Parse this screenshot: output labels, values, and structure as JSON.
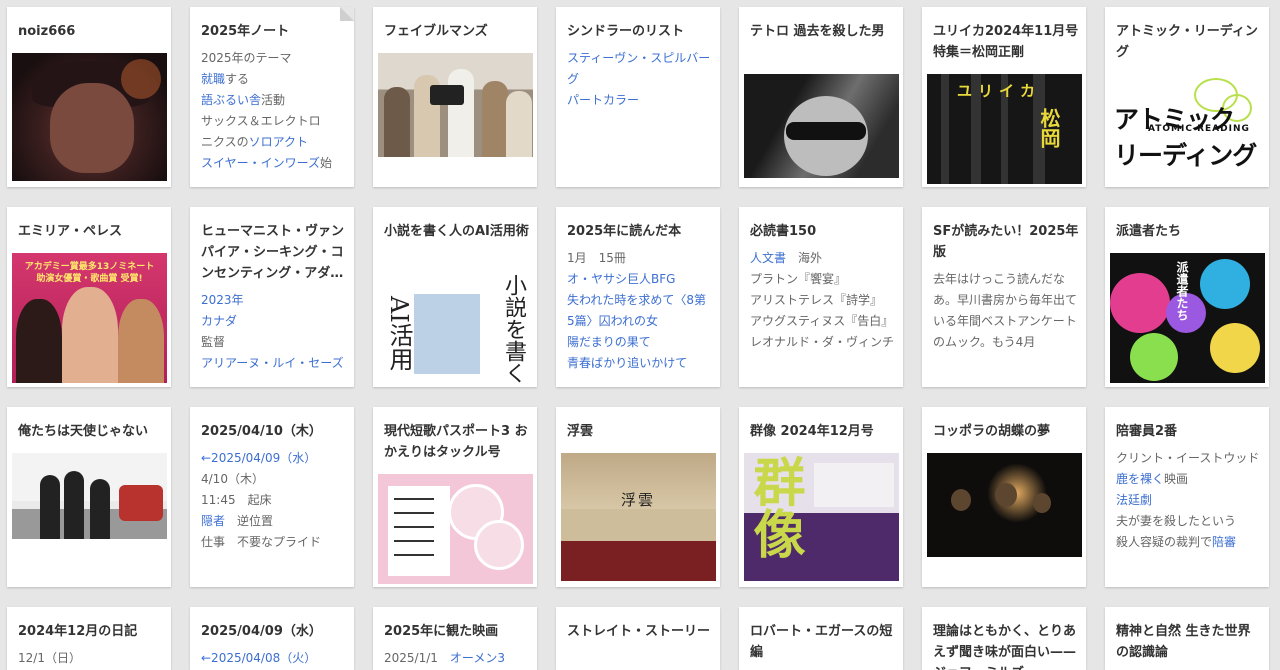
{
  "cards": [
    {
      "title": "noiz666",
      "lines": []
    },
    {
      "title": "2025年ノート",
      "lines": [
        {
          "text": "2025年のテーマ",
          "link": false
        },
        {
          "text": "就職",
          "link": true,
          "rest": "する"
        },
        {
          "text": "語ぶるい舎",
          "link": true,
          "rest": "活動"
        },
        {
          "text": "サックス＆エレクトロ",
          "link": false
        },
        {
          "pre": "ニクスの",
          "text": "ソロアクト",
          "link": true
        },
        {
          "text": "スイヤー・インワーズ",
          "link": true,
          "rest": "始"
        }
      ]
    },
    {
      "title": "フェイブルマンズ",
      "lines": []
    },
    {
      "title": "シンドラーのリスト",
      "lines": [
        {
          "text": "スティーヴン・スピルバーグ",
          "link": true
        },
        {
          "text": "パートカラー",
          "link": true
        }
      ]
    },
    {
      "title": "テトロ 過去を殺した男",
      "lines": []
    },
    {
      "title": "ユリイカ2024年11月号　特集＝松岡正剛",
      "lines": []
    },
    {
      "title": "アトミック・リーディング",
      "lines": []
    },
    {
      "title": "エミリア・ペレス",
      "lines": []
    },
    {
      "title": "ヒューマニスト・ヴァンパイア・シーキング・コンセンティング・アダルト",
      "lines": [
        {
          "text": "2023年",
          "link": true
        },
        {
          "text": "カナダ",
          "link": true
        },
        {
          "text": "監督",
          "link": false
        },
        {
          "text": "アリアーヌ・ルイ・セーズ",
          "link": true
        }
      ]
    },
    {
      "title": "小説を書く人のAI活用術",
      "lines": []
    },
    {
      "title": "2025年に読んだ本",
      "lines": [
        {
          "text": "1月　15冊",
          "link": false
        },
        {
          "text": "オ・ヤサシ巨人BFG",
          "link": true
        },
        {
          "text": "失われた時を求めて〈8第5篇〉囚われの女",
          "link": true
        },
        {
          "text": "陽だまりの果て",
          "link": true
        },
        {
          "text": "青春ばかり追いかけて",
          "link": true
        }
      ]
    },
    {
      "title": "必読書150",
      "lines": [
        {
          "text": "人文書",
          "link": true,
          "rest": "　海外"
        },
        {
          "text": "プラトン『饗宴』",
          "link": false
        },
        {
          "text": "アリストテレス『詩学』",
          "link": false
        },
        {
          "text": "アウグスティヌス『告白』",
          "link": false
        },
        {
          "text": "レオナルド・ダ・ヴィンチ",
          "link": false
        }
      ]
    },
    {
      "title": "SFが読みたい！2025年版",
      "lines": [
        {
          "text": "去年はけっこう読んだなあ。早川書房から毎年出ている年間ベストアンケートのムック。もう4月",
          "link": false
        }
      ]
    },
    {
      "title": "派遣者たち",
      "lines": []
    },
    {
      "title": "俺たちは天使じゃない",
      "lines": []
    },
    {
      "title": "2025/04/10（木）",
      "lines": [
        {
          "text": "←2025/04/09（水）",
          "link": true
        },
        {
          "text": "4/10（木）",
          "link": false
        },
        {
          "text": "11:45　起床",
          "link": false
        },
        {
          "text": "隠者",
          "link": true,
          "rest": "　逆位置"
        },
        {
          "text": "仕事　不要なプライド",
          "link": false
        }
      ]
    },
    {
      "title": "現代短歌パスポート3 おかえりはタックル号",
      "lines": []
    },
    {
      "title": "浮雲",
      "lines": []
    },
    {
      "title": "群像 2024年12月号",
      "lines": []
    },
    {
      "title": "コッポラの胡蝶の夢",
      "lines": []
    },
    {
      "title": "陪審員2番",
      "lines": [
        {
          "text": "クリント・イーストウッド",
          "link": false
        },
        {
          "text": "鹿を裸く",
          "link": true,
          "rest": "映画"
        },
        {
          "text": "法廷劇",
          "link": true
        },
        {
          "text": "夫が妻を殺したという",
          "link": false
        },
        {
          "pre": "殺人容疑の裁判で",
          "text": "陪審",
          "link": true
        }
      ]
    },
    {
      "title": "2024年12月の日記",
      "lines": [
        {
          "text": "12/1（日）",
          "link": false
        }
      ]
    },
    {
      "title": "2025/04/09（水）",
      "lines": [
        {
          "text": "←2025/04/08（火）",
          "link": true
        }
      ]
    },
    {
      "title": "2025年に観た映画",
      "lines": [
        {
          "text": "2025/1/1　",
          "link": false,
          "tail": "オーメン3"
        }
      ]
    },
    {
      "title": "ストレイト・ストーリー",
      "lines": []
    },
    {
      "title": "ロバート・エガースの短編",
      "lines": []
    },
    {
      "title": "理論はともかく、とりあえず聞き味が面白い——ジェフ・ミルズ",
      "lines": []
    },
    {
      "title": "精神と自然 生きた世界の認識論",
      "lines": []
    }
  ],
  "thumbs": {
    "eureka_text": [
      "ユリイカ",
      "松岡"
    ],
    "atomic_text": [
      "アトミック",
      "ATOMIC READING",
      "リーディング"
    ],
    "emilia_text": "アカデミー賞最多13ノミネート 助演女優賞・歌曲賞 受賞!",
    "novel_text": [
      "小説を書く",
      "AI活用"
    ],
    "haken_text": "派遣者たち",
    "ukigumo_text": "浮雲",
    "gunzo_text": "群像"
  }
}
